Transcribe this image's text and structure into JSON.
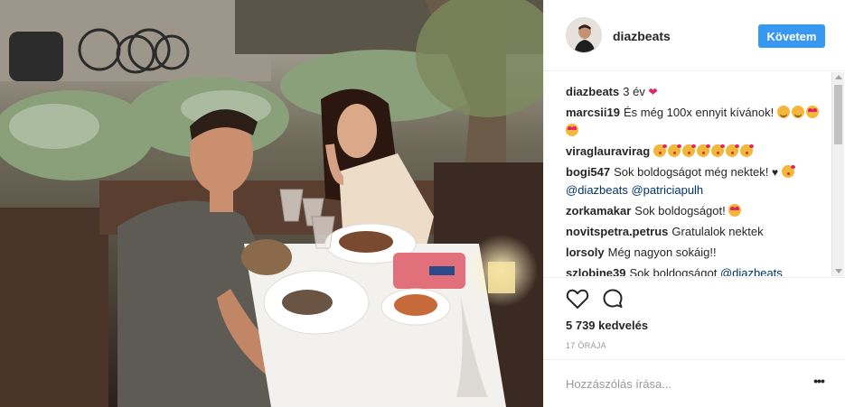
{
  "post": {
    "username": "diazbeats",
    "follow_label": "Követem",
    "photo_description_icon": "couple-dinner-photo"
  },
  "comments": [
    {
      "user": "diazbeats",
      "parts": [
        {
          "t": "text",
          "v": "3 év"
        },
        {
          "t": "heart",
          "v": "❤"
        }
      ]
    },
    {
      "user": "marcsii19",
      "parts": [
        {
          "t": "text",
          "v": "És még 100x ennyit kívánok!"
        },
        {
          "t": "emo",
          "v": "blush"
        },
        {
          "t": "emo",
          "v": "blush"
        },
        {
          "t": "emo",
          "v": "heart-eyes"
        },
        {
          "t": "emo",
          "v": "heart-eyes"
        }
      ]
    },
    {
      "user": "viraglauravirag",
      "parts": [
        {
          "t": "emo",
          "v": "kiss"
        },
        {
          "t": "emo",
          "v": "kiss"
        },
        {
          "t": "emo",
          "v": "kiss"
        },
        {
          "t": "emo",
          "v": "kiss"
        },
        {
          "t": "emo",
          "v": "kiss"
        },
        {
          "t": "emo",
          "v": "kiss"
        },
        {
          "t": "emo",
          "v": "kiss"
        }
      ]
    },
    {
      "user": "bogi547",
      "parts": [
        {
          "t": "text",
          "v": "Sok boldogságot még nektek!"
        },
        {
          "t": "heart-black",
          "v": "♥"
        },
        {
          "t": "emo",
          "v": "kiss"
        },
        {
          "t": "mention",
          "v": "@diazbeats"
        },
        {
          "t": "text",
          "v": " "
        },
        {
          "t": "mention",
          "v": "@patriciapulh"
        }
      ]
    },
    {
      "user": "zorkamakar",
      "parts": [
        {
          "t": "text",
          "v": "Sok boldogságot!"
        },
        {
          "t": "emo",
          "v": "heart-eyes"
        }
      ]
    },
    {
      "user": "novitspetra.petrus",
      "parts": [
        {
          "t": "text",
          "v": "Gratulalok nektek"
        }
      ]
    },
    {
      "user": "lorsoly",
      "parts": [
        {
          "t": "text",
          "v": "Még nagyon sokáig!!"
        }
      ]
    },
    {
      "user": "szlobine39",
      "parts": [
        {
          "t": "text",
          "v": "Sok boldogságot "
        },
        {
          "t": "mention",
          "v": "@diazbeats"
        }
      ]
    }
  ],
  "actions": {
    "likes": "5 739 kedvelés",
    "time": "17 órája",
    "comment_placeholder": "Hozzászólás írása...",
    "more_label": "•••"
  },
  "colors": {
    "follow_button": "#3897f0",
    "mention": "#003569",
    "heart": "#e0245e"
  }
}
